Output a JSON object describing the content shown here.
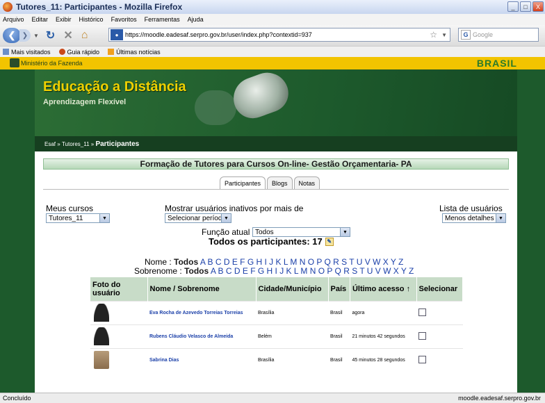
{
  "window": {
    "title": "Tutores_11: Participantes - Mozilla Firefox",
    "controls": [
      "_",
      "□",
      "X"
    ]
  },
  "menu": [
    "Arquivo",
    "Editar",
    "Exibir",
    "Histórico",
    "Favoritos",
    "Ferramentas",
    "Ajuda"
  ],
  "nav": {
    "url": "https://moodle.eadesaf.serpro.gov.br/user/index.php?contextid=937",
    "search_placeholder": "Google"
  },
  "bookmarks": [
    "Mais visitados",
    "Guia rápido",
    "Últimas notícias"
  ],
  "gov": {
    "ministry": "Ministério da Fazenda",
    "brasil": "BRASIL"
  },
  "banner": {
    "title": "Educação a Distância",
    "subtitle": "Aprendizagem Flexível"
  },
  "breadcrumb": {
    "item1": "Esaf",
    "item2": "Tutores_11",
    "current": "Participantes",
    "sep": "»"
  },
  "course_title": "Formação de Tutores para Cursos On-line- Gestão Orçamentaria- PA",
  "tabs": [
    "Participantes",
    "Blogs",
    "Notas"
  ],
  "filters": {
    "my_courses_label": "Meus cursos",
    "my_courses_value": "Tutores_11",
    "inactive_label": "Mostrar usuários inativos por mais de",
    "inactive_value": "Selecionar período",
    "role_label": "Função atual",
    "role_value": "Todos",
    "list_label": "Lista de usuários",
    "list_value": "Menos detalhes"
  },
  "total": "Todos os participantes: 17",
  "name_filter": {
    "label": "Nome :",
    "all": "Todos",
    "letters": "A B C D E F G H I J K L M N O P Q R S T U V W X Y Z"
  },
  "surname_filter": {
    "label": "Sobrenome :",
    "all": "Todos",
    "letters": "A B C D E F G H I J K L M N O P Q R S T U V W X Y Z"
  },
  "table": {
    "headers": [
      "Foto do usuário",
      "Nome / Sobrenome",
      "Cidade/Município",
      "País",
      "Último acesso ↑",
      "Selecionar"
    ],
    "rows": [
      {
        "name": "Eva Rocha de Azevedo Torreias Torreias",
        "city": "Brasília",
        "country": "Brasil",
        "last": "agora"
      },
      {
        "name": "Rubens Cláudio Velasco de Almeida",
        "city": "Belém",
        "country": "Brasil",
        "last": "21 minutos 42 segundos"
      },
      {
        "name": "Sabrina Dias",
        "city": "Brasília",
        "country": "Brasil",
        "last": "45 minutos 28 segundos"
      }
    ]
  },
  "status": {
    "left": "Concluído",
    "right": "moodle.eadesaf.serpro.gov.br"
  },
  "colors": {
    "gov_yellow": "#f2c400",
    "site_green": "#1d5a2c",
    "header_row": "#c8dcc8",
    "link_blue": "#1a3fa8"
  }
}
